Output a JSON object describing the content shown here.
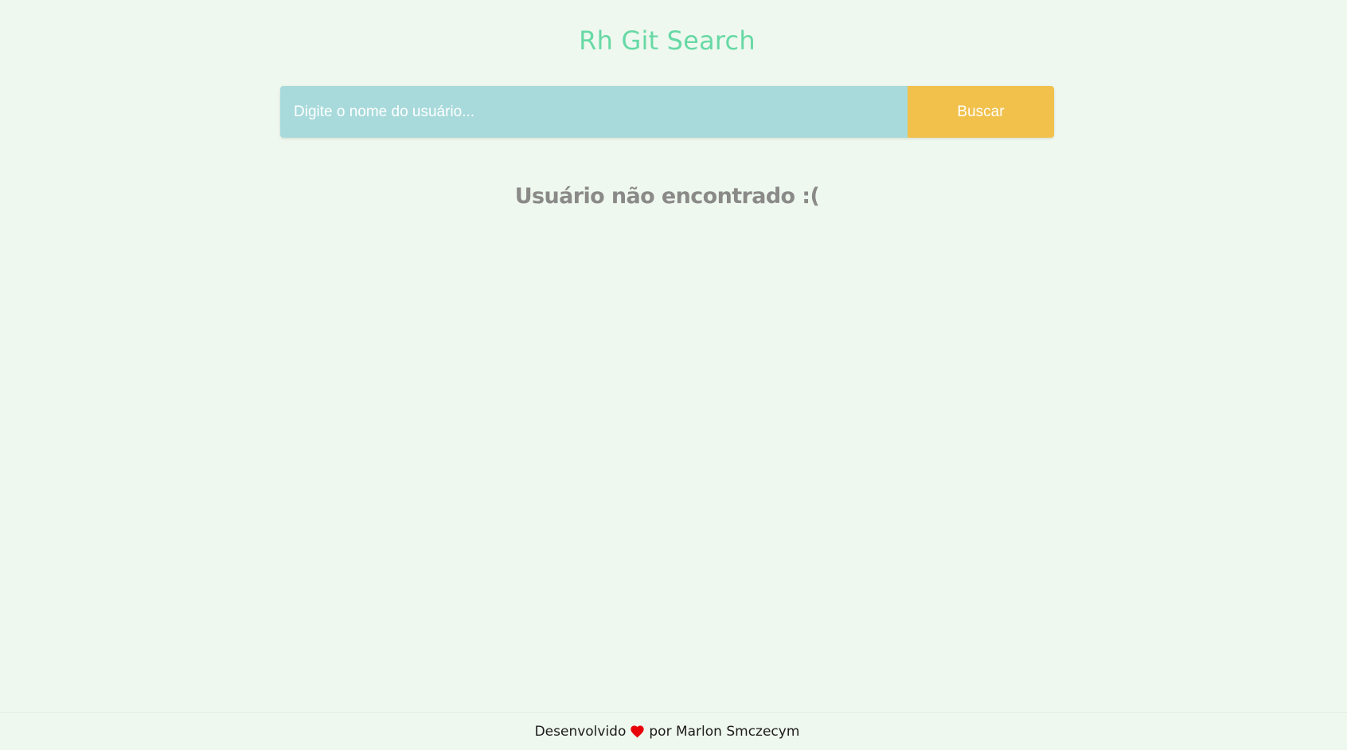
{
  "header": {
    "title": "Rh Git Search"
  },
  "search": {
    "placeholder": "Digite o nome do usuário...",
    "value": "",
    "button_label": "Buscar"
  },
  "result": {
    "message": "Usuário não encontrado :("
  },
  "footer": {
    "prefix": "Desenvolvido",
    "icon": "heart-icon",
    "suffix": "por Marlon Smczecym"
  },
  "colors": {
    "background": "#eff8ee",
    "title": "#67d9a6",
    "input_bg": "#a8dadb",
    "button_bg": "#f1c14c",
    "message": "#8a8a88",
    "heart": "#e8000b"
  }
}
